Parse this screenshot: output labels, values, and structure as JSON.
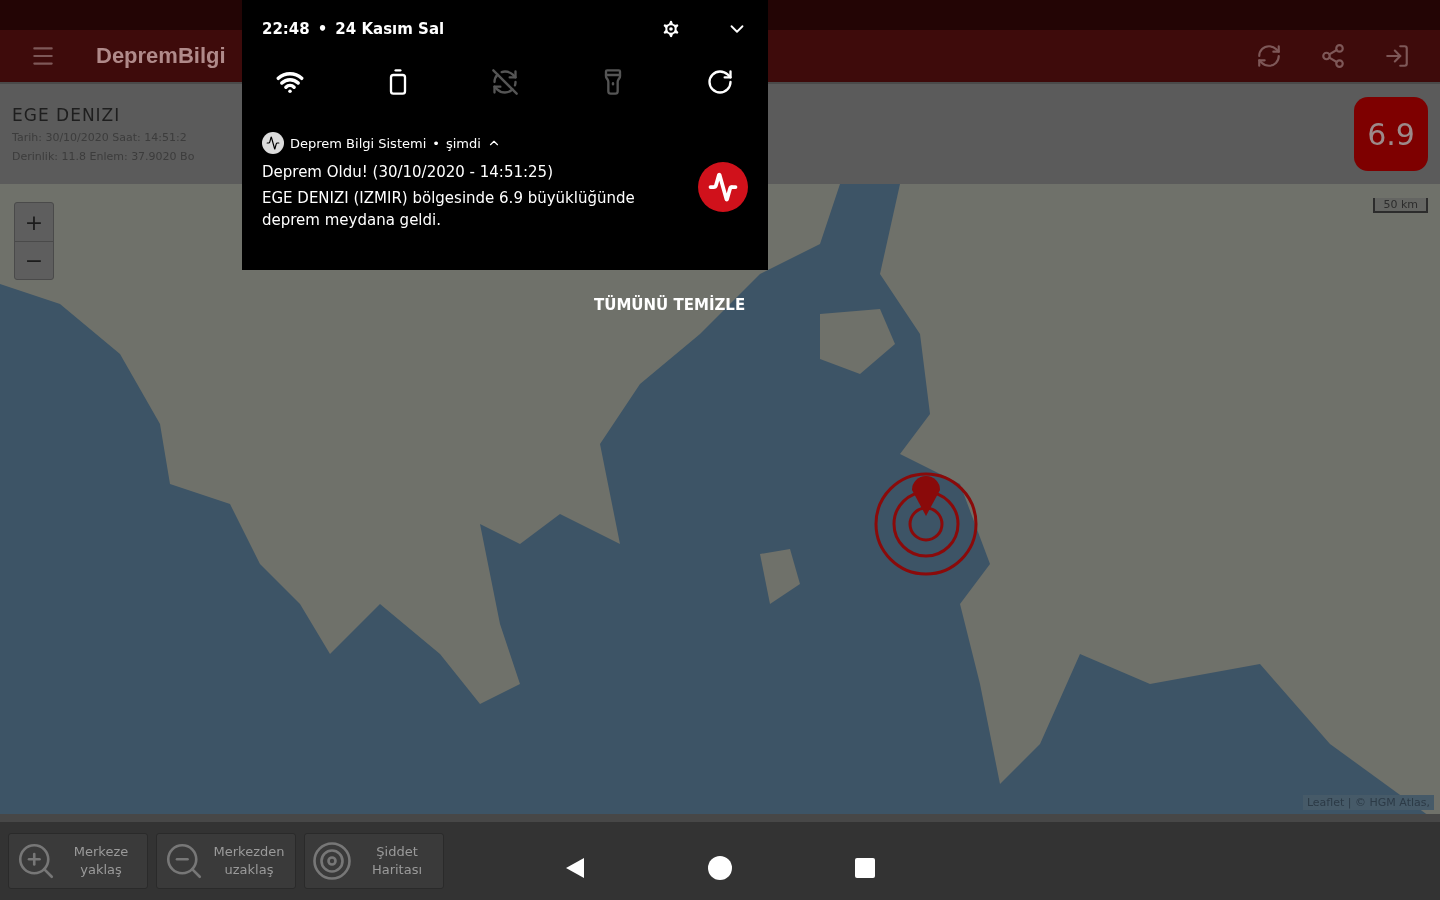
{
  "app_bar": {
    "title": "DepremBilgi"
  },
  "event": {
    "region": "EGE DENIZI",
    "date_line": "Tarih: 30/10/2020 Saat: 14:51:2",
    "depth_line": "Derinlik: 11.8 Enlem: 37.9020 Bo",
    "magnitude": "6.9"
  },
  "map": {
    "scale": "50 km",
    "attribution": "Leaflet | © HGM Atlas,",
    "zoom_in": "+",
    "zoom_out": "−"
  },
  "bottom_buttons": [
    {
      "kind": "zoom-in",
      "label": "Merkeze yaklaş"
    },
    {
      "kind": "zoom-out",
      "label": "Merkezden uzaklaş"
    },
    {
      "kind": "rings",
      "label": "Şiddet Haritası"
    }
  ],
  "notification_shade": {
    "time": "22:48",
    "separator": "•",
    "date": "24 Kasım Sal",
    "tiles": [
      {
        "kind": "wifi",
        "on": true
      },
      {
        "kind": "battery",
        "on": true
      },
      {
        "kind": "sync",
        "on": false
      },
      {
        "kind": "flashlight",
        "on": false
      },
      {
        "kind": "rotate",
        "on": true
      }
    ],
    "notification": {
      "app": "Deprem Bilgi Sistemi",
      "separator": "•",
      "when": "şimdi",
      "title": "Deprem Oldu! (30/10/2020 - 14:51:25)",
      "body": "EGE DENIZI (IZMIR) bölgesinde 6.9 büyüklüğünde deprem meydana geldi."
    },
    "clear_all": "TÜMÜNÜ TEMİZLE"
  }
}
